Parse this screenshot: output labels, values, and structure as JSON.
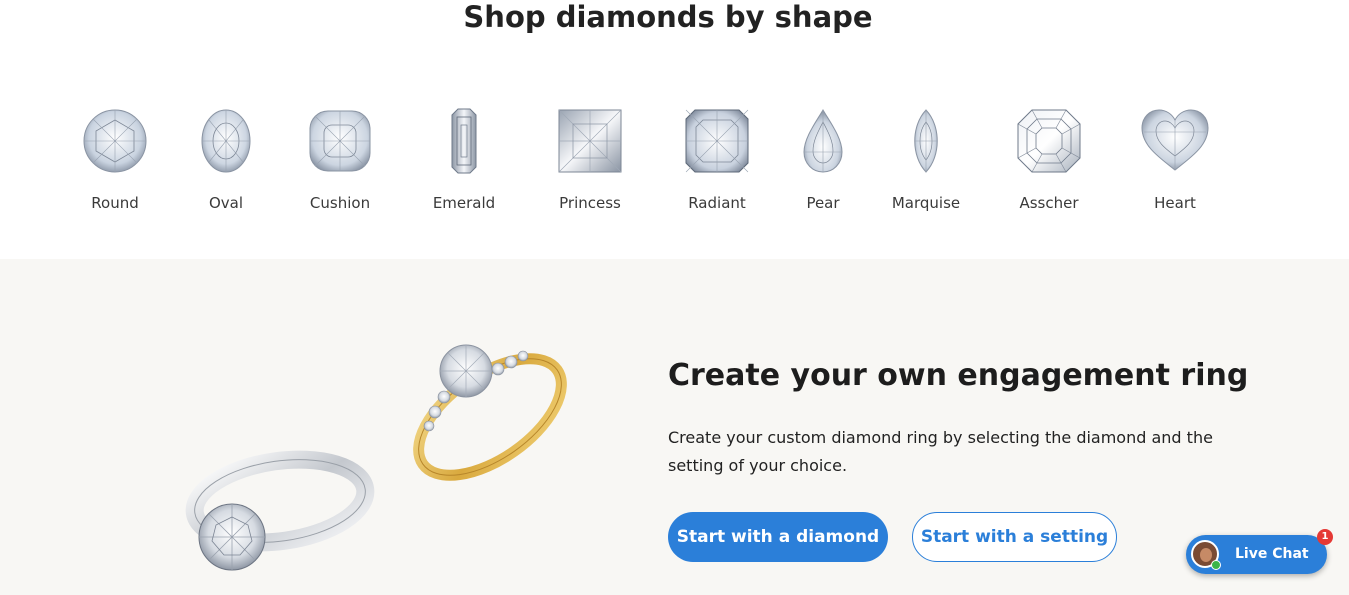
{
  "section_title": "Shop diamonds by shape",
  "shapes": [
    {
      "label": "Round",
      "icon": "round-diamond-icon"
    },
    {
      "label": "Oval",
      "icon": "oval-diamond-icon"
    },
    {
      "label": "Cushion",
      "icon": "cushion-diamond-icon"
    },
    {
      "label": "Emerald",
      "icon": "emerald-diamond-icon"
    },
    {
      "label": "Princess",
      "icon": "princess-diamond-icon"
    },
    {
      "label": "Radiant",
      "icon": "radiant-diamond-icon"
    },
    {
      "label": "Pear",
      "icon": "pear-diamond-icon"
    },
    {
      "label": "Marquise",
      "icon": "marquise-diamond-icon"
    },
    {
      "label": "Asscher",
      "icon": "asscher-diamond-icon"
    },
    {
      "label": "Heart",
      "icon": "heart-diamond-icon"
    }
  ],
  "promo": {
    "heading": "Create your own engagement ring",
    "text": "Create your custom diamond ring by selecting the diamond and the setting of your choice.",
    "primary_button": "Start with a diamond",
    "secondary_button": "Start with a setting"
  },
  "chat": {
    "label": "Live Chat",
    "badge": "1"
  },
  "colors": {
    "accent": "#2b7fd9",
    "promo_background": "#f8f7f4",
    "badge": "#e53935",
    "gold": "#e0b94f"
  }
}
